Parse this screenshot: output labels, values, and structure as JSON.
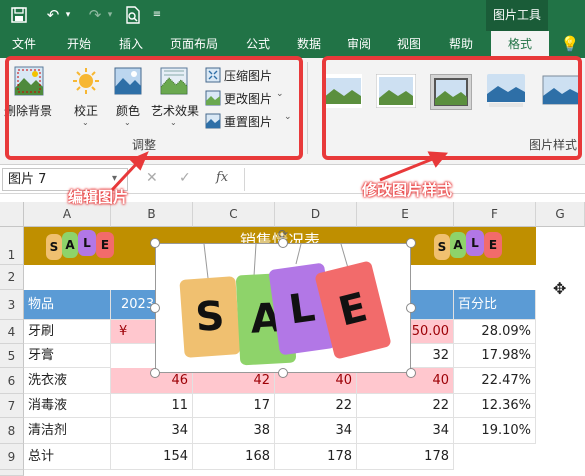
{
  "titlebar": {
    "context_tab": "图片工具"
  },
  "tabs": [
    "文件",
    "开始",
    "插入",
    "页面布局",
    "公式",
    "数据",
    "审阅",
    "视图",
    "帮助",
    "格式"
  ],
  "ribbon": {
    "remove_bg": "删除背景",
    "correct": "校正",
    "color": "颜色",
    "effects": "艺术效果",
    "compress": "压缩图片",
    "change": "更改图片",
    "reset": "重置图片",
    "group_adjust": "调整",
    "group_styles": "图片样式"
  },
  "formula": {
    "namebox": "图片 7",
    "fx": "fx"
  },
  "callouts": {
    "edit": "编辑图片",
    "style": "修改图片样式"
  },
  "columns": [
    "A",
    "B",
    "C",
    "D",
    "E",
    "F",
    "G"
  ],
  "rows": [
    "1",
    "2",
    "3",
    "4",
    "5",
    "6",
    "7",
    "8",
    "9"
  ],
  "sheet": {
    "title": "销售情况表",
    "header": {
      "item": "物品",
      "year": "2023",
      "pct": "百分比"
    },
    "r4": {
      "item": "牙刷",
      "b": "¥",
      "e": "50.00",
      "f": "28.09%"
    },
    "r5": {
      "item": "牙膏",
      "e": "32",
      "f": "17.98%"
    },
    "r6": {
      "item": "洗衣液",
      "b": "46",
      "c": "42",
      "d": "40",
      "e": "40",
      "f": "22.47%"
    },
    "r7": {
      "item": "消毒液",
      "b": "11",
      "c": "17",
      "d": "22",
      "e": "22",
      "f": "12.36%"
    },
    "r8": {
      "item": "清洁剂",
      "b": "34",
      "c": "38",
      "d": "34",
      "e": "34",
      "f": "19.10%"
    },
    "r9": {
      "item": "总计",
      "b": "154",
      "c": "168",
      "d": "178",
      "e": "178"
    }
  },
  "sale_letters": [
    "S",
    "A",
    "L",
    "E"
  ],
  "colors": {
    "excel_green": "#217346",
    "header_blue": "#5b9bd5",
    "title_gold": "#bf8f00",
    "pink": "#ffc7ce",
    "callout_red": "#e8393a"
  }
}
